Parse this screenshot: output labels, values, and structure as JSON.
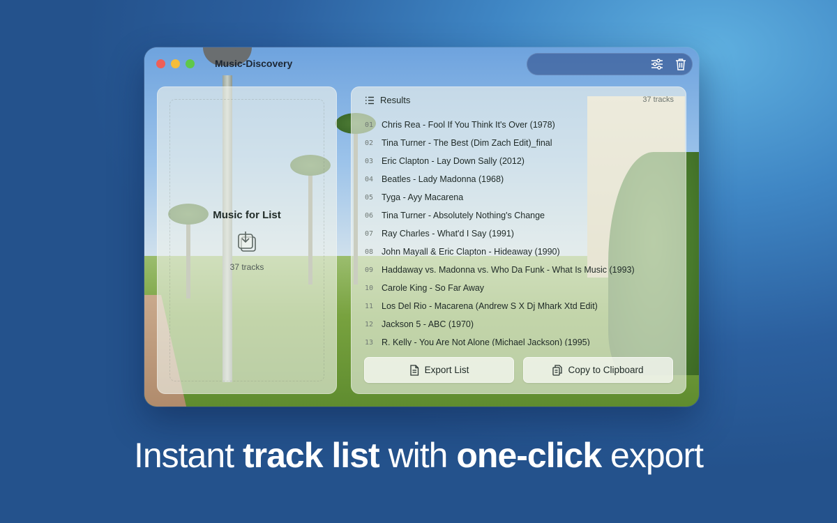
{
  "window": {
    "title": "Music-Discovery"
  },
  "toolbar": {
    "settings_icon": "sliders-icon",
    "delete_icon": "trash-icon"
  },
  "drop_panel": {
    "title": "Music for List",
    "icon": "tray-arrow-down-icon",
    "count": "37 tracks"
  },
  "results": {
    "title": "Results",
    "count": "37 tracks",
    "tracks": [
      {
        "num": "01",
        "name": "Chris Rea - Fool If You Think It's Over (1978)"
      },
      {
        "num": "02",
        "name": "Tina Turner - The Best (Dim Zach Edit)_final"
      },
      {
        "num": "03",
        "name": "Eric Clapton - Lay Down Sally (2012)"
      },
      {
        "num": "04",
        "name": "Beatles - Lady Madonna (1968)"
      },
      {
        "num": "05",
        "name": "Tyga - Ayy Macarena"
      },
      {
        "num": "06",
        "name": "Tina Turner - Absolutely Nothing's Change"
      },
      {
        "num": "07",
        "name": "Ray Charles - What'd I Say (1991)"
      },
      {
        "num": "08",
        "name": "John Mayall & Eric Clapton - Hideaway (1990)"
      },
      {
        "num": "09",
        "name": "Haddaway vs. Madonna vs. Who Da Funk - What Is Music (1993)"
      },
      {
        "num": "10",
        "name": "Carole King - So Far Away"
      },
      {
        "num": "11",
        "name": "Los Del Rio - Macarena (Andrew S X Dj Mhark Xtd Edit)"
      },
      {
        "num": "12",
        "name": "Jackson 5 - ABC (1970)"
      },
      {
        "num": "13",
        "name": "R. Kelly - You Are Not Alone (Michael Jackson) (1995)"
      }
    ]
  },
  "actions": {
    "export_label": "Export List",
    "copy_label": "Copy to Clipboard"
  },
  "headline": {
    "part1": "Instant",
    "part2": "track list",
    "part3": "with",
    "part4": "one-click",
    "part5": "export"
  },
  "colors": {
    "close": "#ee5f57",
    "minimize": "#f5bd3a",
    "zoom": "#5fc84a"
  }
}
